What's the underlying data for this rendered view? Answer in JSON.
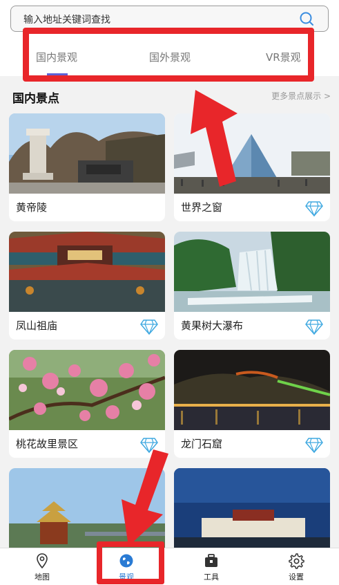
{
  "search": {
    "placeholder": "输入地址关键词查找"
  },
  "tabs": [
    {
      "label": "国内景观"
    },
    {
      "label": "国外景观"
    },
    {
      "label": "VR景观"
    }
  ],
  "section": {
    "title": "国内景点",
    "more": "更多景点展示 >"
  },
  "cards": [
    {
      "name": "黄帝陵",
      "vip": false
    },
    {
      "name": "世界之窗",
      "vip": true
    },
    {
      "name": "凤山祖庙",
      "vip": true
    },
    {
      "name": "黄果树大瀑布",
      "vip": true
    },
    {
      "name": "桃花故里景区",
      "vip": true
    },
    {
      "name": "龙门石窟",
      "vip": true
    },
    {
      "name": "",
      "vip": false
    },
    {
      "name": "",
      "vip": false
    }
  ],
  "nav": [
    {
      "label": "地图",
      "icon": "map-pin-icon"
    },
    {
      "label": "景观",
      "icon": "globe-icon",
      "active": true
    },
    {
      "label": "工具",
      "icon": "toolbox-icon"
    },
    {
      "label": "设置",
      "icon": "gear-icon"
    }
  ],
  "colors": {
    "annotation": "#e8262a",
    "accent": "#2a7bd4",
    "tab_underline": "#5e61d6",
    "diamond": "#3ea8e0"
  }
}
